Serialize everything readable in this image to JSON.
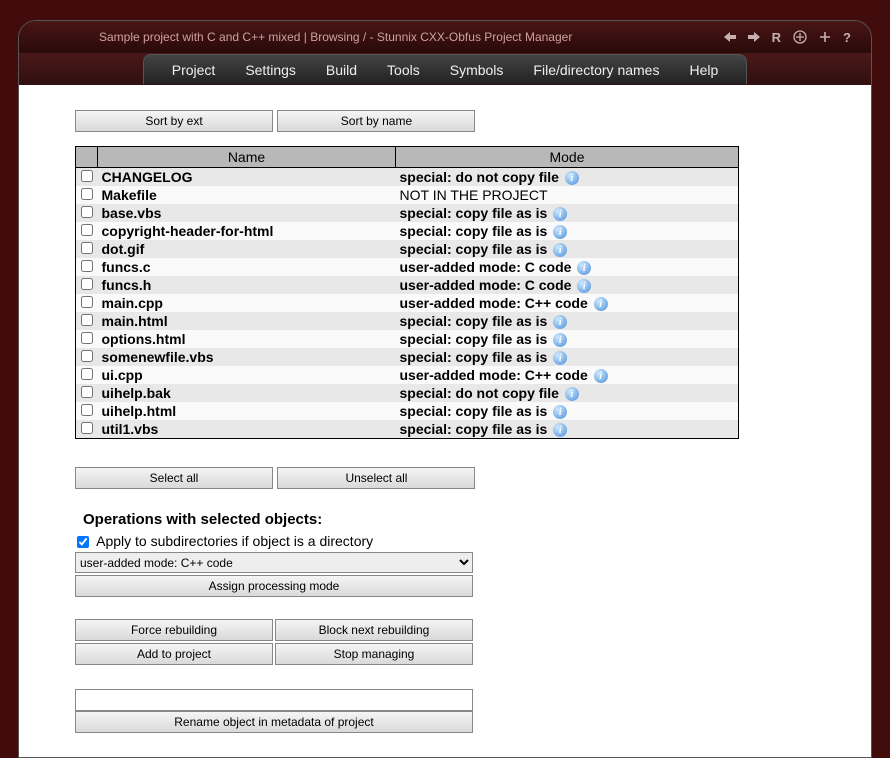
{
  "title": "Sample project with C and C++ mixed | Browsing / - Stunnix CXX-Obfus Project Manager",
  "menu": [
    "Project",
    "Settings",
    "Build",
    "Tools",
    "Symbols",
    "File/directory names",
    "Help"
  ],
  "sort": {
    "by_ext": "Sort by ext",
    "by_name": "Sort by name"
  },
  "headers": {
    "name": "Name",
    "mode": "Mode"
  },
  "rows": [
    {
      "name": "CHANGELOG",
      "mode": "special: do not copy file",
      "info": true
    },
    {
      "name": "Makefile",
      "mode": "NOT IN THE PROJECT",
      "info": false
    },
    {
      "name": "base.vbs",
      "mode": "special: copy file as is",
      "info": true
    },
    {
      "name": "copyright-header-for-html",
      "mode": "special: copy file as is",
      "info": true
    },
    {
      "name": "dot.gif",
      "mode": "special: copy file as is",
      "info": true
    },
    {
      "name": "funcs.c",
      "mode": "user-added mode: C code",
      "info": true
    },
    {
      "name": "funcs.h",
      "mode": "user-added mode: C code",
      "info": true
    },
    {
      "name": "main.cpp",
      "mode": "user-added mode: C++ code",
      "info": true
    },
    {
      "name": "main.html",
      "mode": "special: copy file as is",
      "info": true
    },
    {
      "name": "options.html",
      "mode": "special: copy file as is",
      "info": true
    },
    {
      "name": "somenewfile.vbs",
      "mode": "special: copy file as is",
      "info": true
    },
    {
      "name": "ui.cpp",
      "mode": "user-added mode: C++ code",
      "info": true
    },
    {
      "name": "uihelp.bak",
      "mode": "special: do not copy file",
      "info": true
    },
    {
      "name": "uihelp.html",
      "mode": "special: copy file as is",
      "info": true
    },
    {
      "name": "util1.vbs",
      "mode": "special: copy file as is",
      "info": true
    }
  ],
  "selection": {
    "select_all": "Select all",
    "unselect_all": "Unselect all"
  },
  "ops": {
    "heading": "Operations with selected objects:",
    "apply_subdirs": "Apply to subdirectories if object is a directory",
    "mode_value": "user-added mode: C++ code",
    "assign": "Assign processing mode",
    "force": "Force rebuilding",
    "block": "Block next rebuilding",
    "add": "Add to project",
    "stop": "Stop managing",
    "rename_placeholder": "",
    "rename": "Rename object in metadata of project"
  }
}
